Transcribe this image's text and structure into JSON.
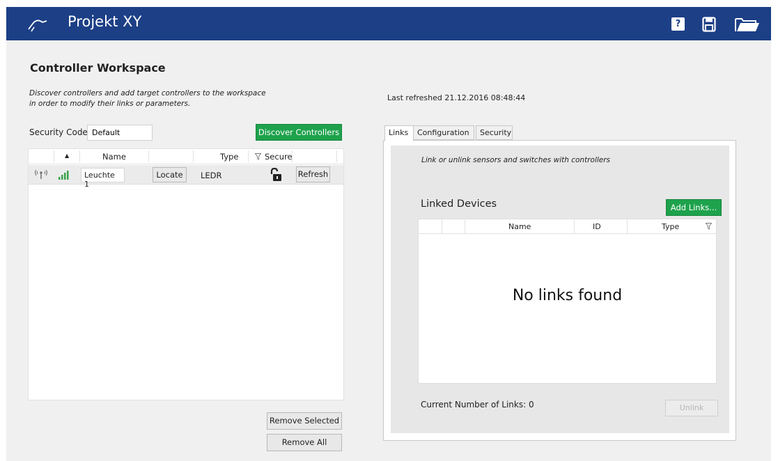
{
  "app": {
    "title": "Projekt XY",
    "help_label": "?"
  },
  "workspace": {
    "title": "Controller Workspace",
    "description_line1": "Discover controllers and add target controllers to the workspace",
    "description_line2": "in order to modify their links or parameters.",
    "security_label": "Security Code",
    "security_value": "Default",
    "discover_label": "Discover Controllers",
    "columns": {
      "sort": "▲",
      "name": "Name",
      "type": "Type",
      "secure": "Secure"
    },
    "rows": [
      {
        "name": "Leuchte 1",
        "locate": "Locate",
        "type": "LEDR",
        "refresh": "Refresh"
      }
    ],
    "remove_selected": "Remove Selected",
    "remove_all": "Remove All"
  },
  "details": {
    "last_refreshed": "Last refreshed 21.12.2016 08:48:44",
    "tabs": [
      "Links",
      "Configuration",
      "Security"
    ],
    "links_description": "Link or unlink sensors and switches with controllers",
    "linked_title": "Linked Devices",
    "add_links": "Add Links...",
    "columns": {
      "name": "Name",
      "id": "ID",
      "type": "Type"
    },
    "empty_message": "No links found",
    "count_label": "Current Number of Links: 0",
    "unlink": "Unlink"
  },
  "colors": {
    "header": "#1c3f86",
    "green_button": "#1ea24c",
    "signal_green": "#3aa34a"
  }
}
